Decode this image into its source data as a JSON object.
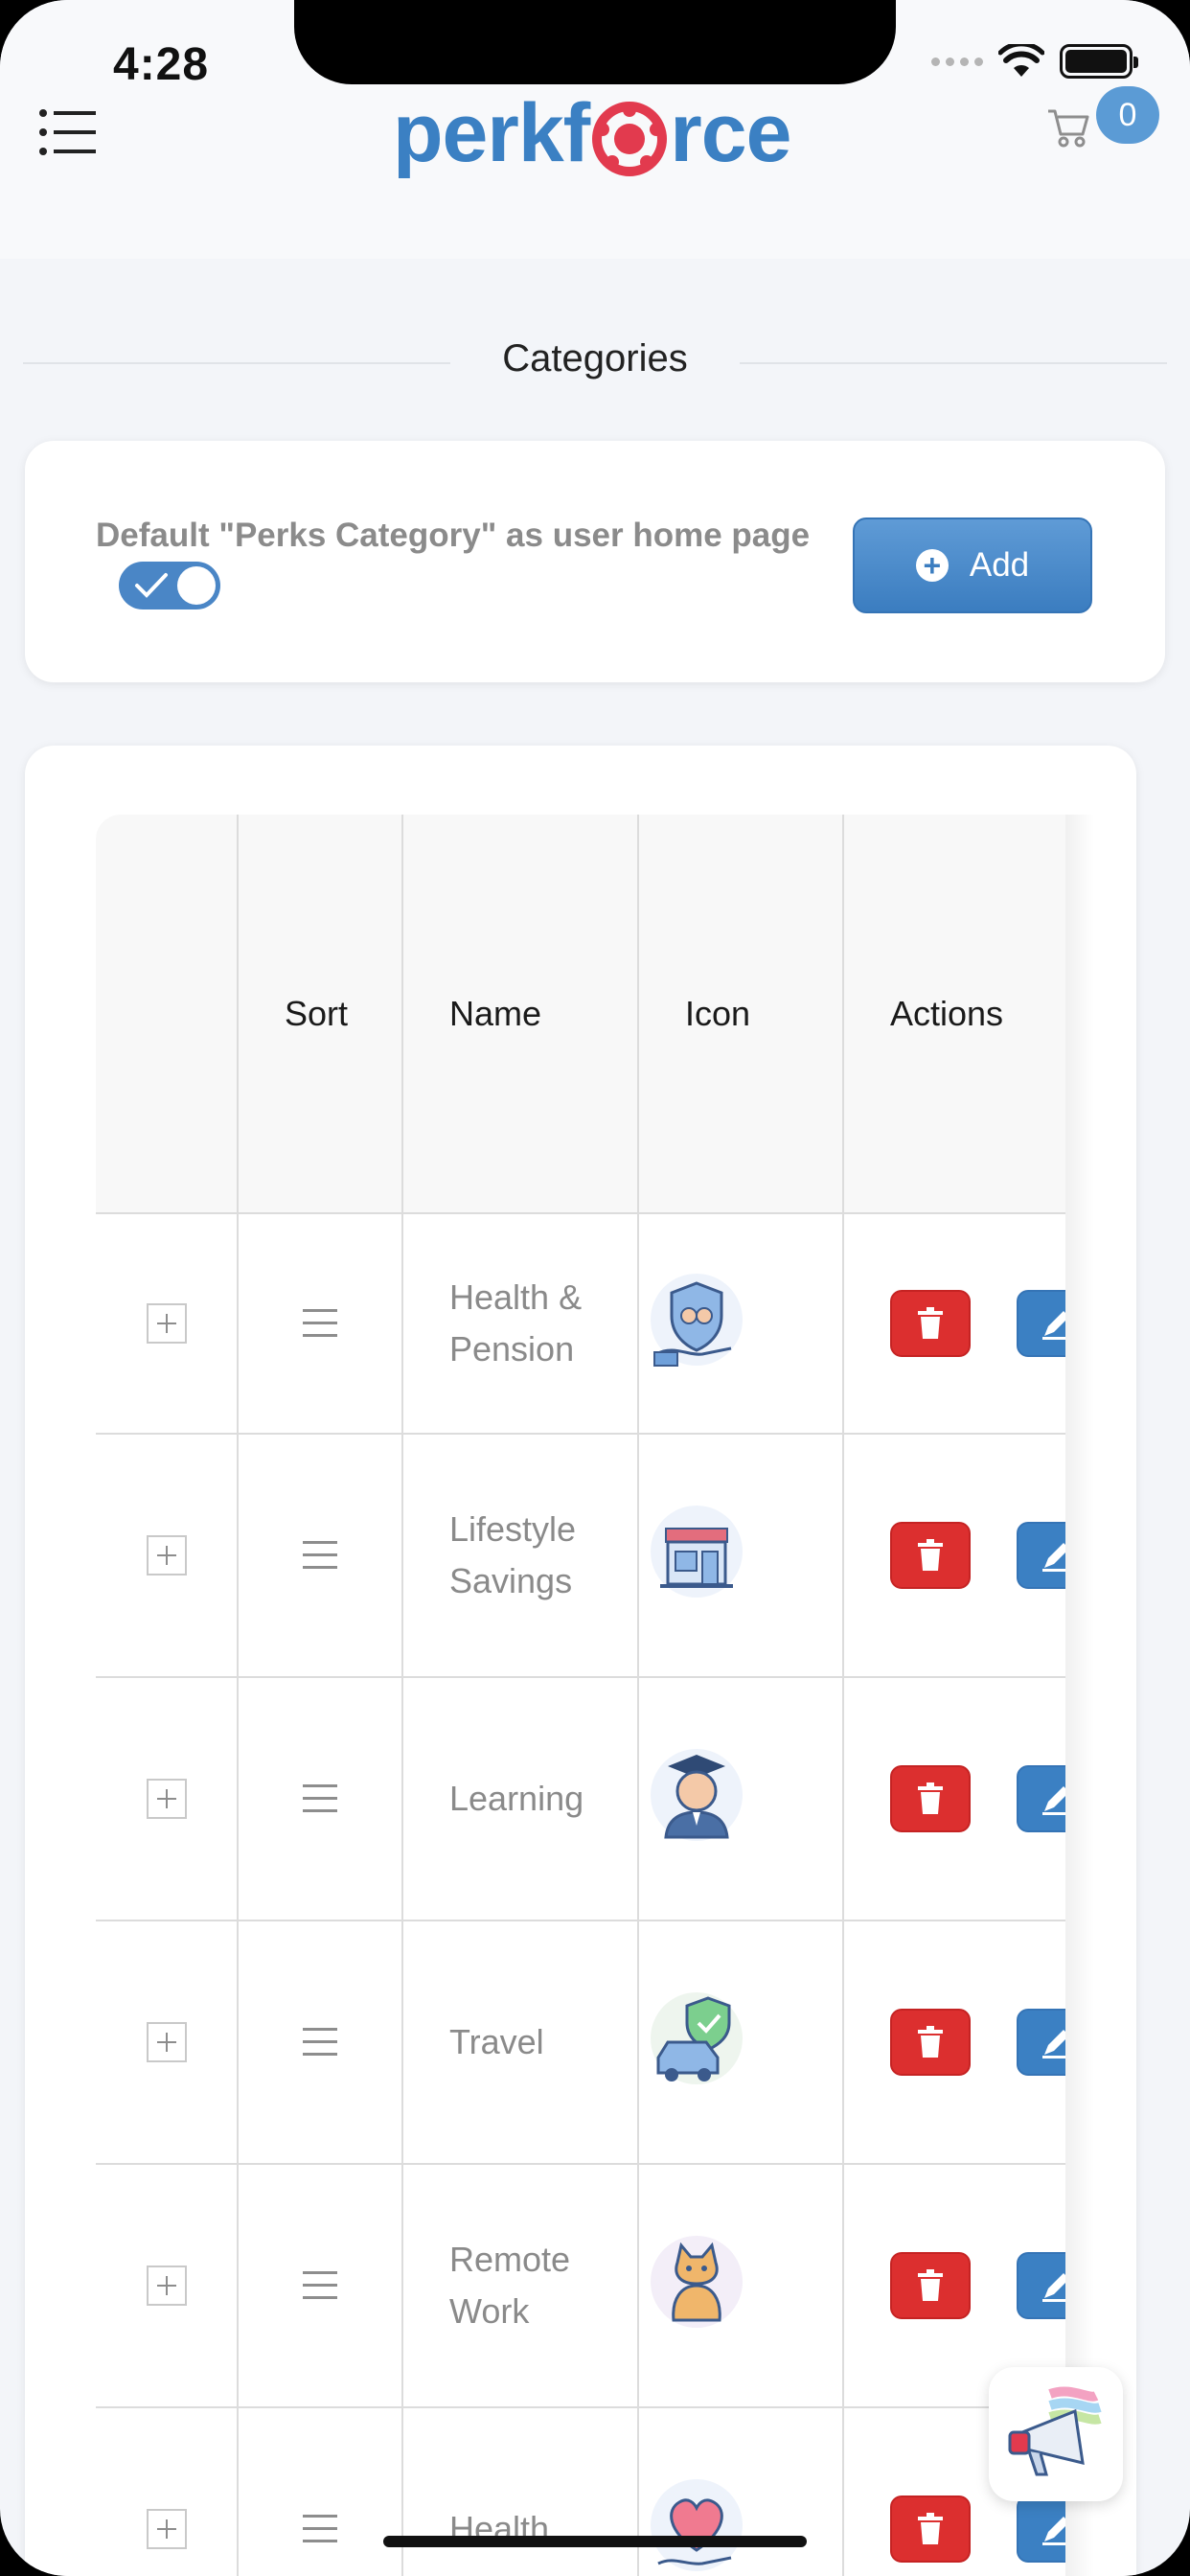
{
  "status_bar": {
    "time": "4:28"
  },
  "header": {
    "logo_left": "perkf",
    "logo_right": "rce",
    "cart_count": "0"
  },
  "section": {
    "title": "Categories"
  },
  "settings_card": {
    "label": "Default \"Perks Category\" as user home page",
    "toggle_on": true,
    "add_label": "Add"
  },
  "table": {
    "columns": [
      "",
      "Sort",
      "Name",
      "Icon",
      "Actions"
    ],
    "rows": [
      {
        "name": "Health & Pension",
        "icon": "shield-hand-icon"
      },
      {
        "name": "Lifestyle Savings",
        "icon": "storefront-icon"
      },
      {
        "name": "Learning",
        "icon": "graduate-icon"
      },
      {
        "name": "Travel",
        "icon": "car-shield-icon"
      },
      {
        "name": "Remote Work",
        "icon": "cat-icon"
      },
      {
        "name": "Health",
        "icon": "heart-hand-icon"
      }
    ]
  },
  "colors": {
    "brand": "#3b80c3",
    "delete": "#dc2f2f",
    "page_bg": "#f3f5f9"
  }
}
